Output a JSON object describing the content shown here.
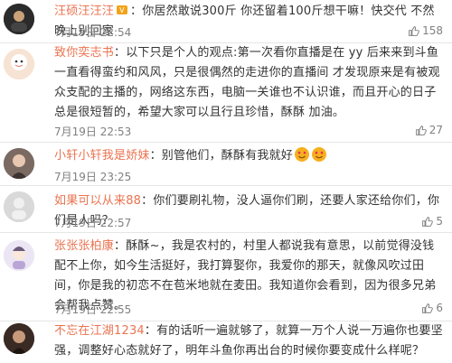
{
  "comments": [
    {
      "username": "汪硕汪汪汪",
      "text": "：你居然敢说300斤 你还留着100斤想干嘛！快交代 不然晚上别回家",
      "time": "7月19日 22:54",
      "likes": "158",
      "avatar_color": "#2b2b2b",
      "avatar_icon": "user-avatar-icon"
    },
    {
      "username": "致你奕志书",
      "text": "：以下只是个人的观点:第一次看你直播是在 yy 后来来到斗鱼 一直看得蛮约和风风，只是很偶然的走进你的直播间 才发现原来是有被观众支配的主播的，网络这东西，电脑一关谁也不认识谁，而且开心的日子总是很短暂的，希望大家可以且行且珍惜，酥酥 加油。",
      "time": "7月19日 22:53",
      "likes": "27",
      "avatar_color": "#f3d9c7",
      "avatar_icon": "user-avatar-icon"
    },
    {
      "username": "小轩小轩我是娇妹",
      "text": "：别管他们，酥酥有我就好",
      "time": "7月19日 23:25",
      "likes": "",
      "avatar_color": "#7a6a62",
      "avatar_icon": "user-avatar-icon"
    },
    {
      "username": "如果可以从来88",
      "text": "：你们要刷礼物，没人逼你们刷，还要人家还给你们，你们是人吗？",
      "time": "7月19日 22:57",
      "likes": "5",
      "avatar_color": "#d4d4d4",
      "avatar_icon": "user-avatar-icon"
    },
    {
      "username": "张张张柏康",
      "text": "：酥酥~，我是农村的，村里人都说我有意思，以前觉得没钱配不上你，如今生活挺好，我打算娶你，我爱你的那天，就像风吹过田间，你是我的初恋不在苞米地就在麦田。我知道你会看到，因为很多兄弟会帮我点赞。",
      "time": "7月19日 22:55",
      "likes": "6",
      "avatar_color": "#e9e4f2",
      "avatar_icon": "user-avatar-icon"
    },
    {
      "username": "不忘在江湖1234",
      "text": "：有的话听一遍就够了，就算一万个人说一万遍你也要坚强，调整好心态就好了，明年斗鱼你再出台的时候你要变成什么样呢？",
      "time": "",
      "likes": "",
      "avatar_color": "#3a2a24",
      "avatar_icon": "user-avatar-icon"
    }
  ],
  "colors": {
    "username": "#eb7350",
    "text": "#333333",
    "meta": "#808080",
    "separator": "#e6e6e6"
  },
  "icons": {
    "like": "thumbs-up-icon",
    "badge": "gold-badge-icon",
    "emoji": "heart-eyes-emoji-icon"
  }
}
